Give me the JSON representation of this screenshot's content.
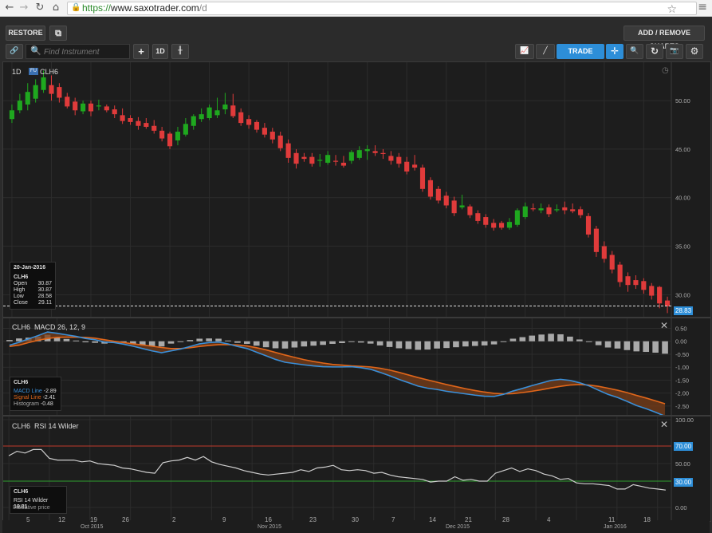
{
  "browser": {
    "url_scheme": "https://",
    "url_host": "www.saxotrader.com",
    "url_path": "/d",
    "back_icon": "←",
    "forward_icon": "→",
    "reload_icon": "↻",
    "home_icon": "⌂",
    "star_icon": "☆",
    "menu_icon": "≡"
  },
  "toolbar": {
    "restore_label": "RESTORE",
    "popout_icon": "⧉",
    "add_remove_label": "ADD / REMOVE CHARTS",
    "link_icon": "🔗",
    "search_icon": "🔍",
    "find_placeholder": "Find Instrument",
    "plus_icon": "+",
    "interval_label": "1D",
    "candles_icon": "╫",
    "indicators_icon": "📈",
    "draw_icon": "╱",
    "trade_label": "TRADE",
    "crosshair_icon": "✛",
    "zoom_icon": "🔍",
    "refresh_icon": "↻",
    "camera_icon": "📷",
    "settings_icon": "⚙"
  },
  "main_chart": {
    "interval": "1D",
    "fu_badge": "FU",
    "symbol": "CLH6",
    "clock_icon": "◷",
    "info": {
      "date": "20-Jan-2016",
      "symbol": "CLH6",
      "open_label": "Open",
      "open": "30.87",
      "high_label": "High",
      "high": "30.87",
      "low_label": "Low",
      "low": "28.58",
      "close_label": "Close",
      "close": "29.11"
    },
    "last_price": "28.83"
  },
  "macd_panel": {
    "title_symbol": "CLH6",
    "title": "MACD 26, 12, 9",
    "close_icon": "✕",
    "info": {
      "symbol": "CLH6",
      "macd_label": "MACD Line",
      "macd": "-2.89",
      "signal_label": "Signal Line",
      "signal": "-2.41",
      "hist_label": "Histogram",
      "hist": "-0.48"
    }
  },
  "rsi_panel": {
    "title_symbol": "CLH6",
    "title": "RSI 14 Wilder",
    "close_icon": "✕",
    "info": {
      "symbol": "CLH6",
      "rsi_label": "RSI 14 Wilder",
      "rsi": "19.81"
    },
    "indicative": "Indicative price",
    "upper_level": "70.00",
    "lower_level": "30.00"
  },
  "x_axis": {
    "days": [
      "5",
      "12",
      "19",
      "26",
      "2",
      "9",
      "16",
      "23",
      "30",
      "7",
      "14",
      "21",
      "28",
      "4",
      "11",
      "18"
    ],
    "months": [
      "Oct 2015",
      "Nov 2015",
      "Dec 2015",
      "Jan 2016"
    ]
  },
  "colors": {
    "up": "#1fa81f",
    "down": "#e03b3b",
    "macd": "#3a8fd8",
    "signal": "#e0661a",
    "rsi": "#cfcfcf",
    "accent": "#2d8ed8"
  },
  "chart_data": [
    {
      "type": "candlestick",
      "title": "CLH6",
      "y_ticks": [
        "50.00",
        "45.00",
        "40.00",
        "35.00",
        "30.00"
      ],
      "ylim": [
        28.3,
        53.3
      ],
      "candles": [
        {
          "o": 48.1,
          "h": 49.6,
          "l": 47.7,
          "c": 49.0
        },
        {
          "o": 49.0,
          "h": 50.7,
          "l": 48.7,
          "c": 50.0
        },
        {
          "o": 49.6,
          "h": 51.8,
          "l": 49.0,
          "c": 50.9
        },
        {
          "o": 50.2,
          "h": 52.2,
          "l": 49.8,
          "c": 51.6
        },
        {
          "o": 51.1,
          "h": 53.1,
          "l": 50.8,
          "c": 52.4
        },
        {
          "o": 51.6,
          "h": 52.6,
          "l": 50.0,
          "c": 50.7
        },
        {
          "o": 51.4,
          "h": 51.8,
          "l": 49.8,
          "c": 50.3
        },
        {
          "o": 50.4,
          "h": 50.8,
          "l": 49.2,
          "c": 49.4
        },
        {
          "o": 49.9,
          "h": 50.3,
          "l": 48.5,
          "c": 49.0
        },
        {
          "o": 48.9,
          "h": 50.0,
          "l": 48.6,
          "c": 49.7
        },
        {
          "o": 49.7,
          "h": 50.0,
          "l": 48.4,
          "c": 48.9
        },
        {
          "o": 49.4,
          "h": 50.1,
          "l": 49.0,
          "c": 49.5
        },
        {
          "o": 49.4,
          "h": 49.6,
          "l": 48.8,
          "c": 49.0
        },
        {
          "o": 49.1,
          "h": 49.5,
          "l": 48.2,
          "c": 48.6
        },
        {
          "o": 48.5,
          "h": 49.2,
          "l": 47.6,
          "c": 47.9
        },
        {
          "o": 48.2,
          "h": 48.5,
          "l": 47.5,
          "c": 47.8
        },
        {
          "o": 47.9,
          "h": 48.3,
          "l": 47.0,
          "c": 47.4
        },
        {
          "o": 47.7,
          "h": 48.2,
          "l": 47.1,
          "c": 47.3
        },
        {
          "o": 47.4,
          "h": 48.0,
          "l": 46.6,
          "c": 46.9
        },
        {
          "o": 46.9,
          "h": 47.3,
          "l": 45.8,
          "c": 46.1
        },
        {
          "o": 46.6,
          "h": 46.8,
          "l": 45.0,
          "c": 45.3
        },
        {
          "o": 45.9,
          "h": 47.3,
          "l": 45.4,
          "c": 46.8
        },
        {
          "o": 46.5,
          "h": 48.2,
          "l": 46.3,
          "c": 47.6
        },
        {
          "o": 47.4,
          "h": 48.6,
          "l": 47.0,
          "c": 48.4
        },
        {
          "o": 48.1,
          "h": 49.2,
          "l": 47.8,
          "c": 48.6
        },
        {
          "o": 48.2,
          "h": 49.6,
          "l": 48.0,
          "c": 49.3
        },
        {
          "o": 48.5,
          "h": 50.3,
          "l": 48.2,
          "c": 49.0
        },
        {
          "o": 49.1,
          "h": 50.8,
          "l": 48.6,
          "c": 49.6
        },
        {
          "o": 49.5,
          "h": 50.7,
          "l": 48.2,
          "c": 48.4
        },
        {
          "o": 48.8,
          "h": 49.2,
          "l": 47.4,
          "c": 47.7
        },
        {
          "o": 48.1,
          "h": 48.5,
          "l": 47.1,
          "c": 47.5
        },
        {
          "o": 47.8,
          "h": 48.0,
          "l": 46.7,
          "c": 47.0
        },
        {
          "o": 47.2,
          "h": 47.7,
          "l": 46.2,
          "c": 46.5
        },
        {
          "o": 46.8,
          "h": 47.2,
          "l": 45.6,
          "c": 46.0
        },
        {
          "o": 46.4,
          "h": 46.8,
          "l": 44.8,
          "c": 45.1
        },
        {
          "o": 45.6,
          "h": 46.0,
          "l": 43.6,
          "c": 44.1
        },
        {
          "o": 44.6,
          "h": 45.0,
          "l": 43.0,
          "c": 43.5
        },
        {
          "o": 44.2,
          "h": 44.6,
          "l": 43.7,
          "c": 44.0
        },
        {
          "o": 44.2,
          "h": 44.6,
          "l": 43.2,
          "c": 43.5
        },
        {
          "o": 43.8,
          "h": 44.5,
          "l": 43.2,
          "c": 43.9
        },
        {
          "o": 43.6,
          "h": 44.8,
          "l": 43.4,
          "c": 44.4
        },
        {
          "o": 43.8,
          "h": 44.4,
          "l": 43.3,
          "c": 43.7
        },
        {
          "o": 43.6,
          "h": 44.3,
          "l": 43.1,
          "c": 43.3
        },
        {
          "o": 43.8,
          "h": 44.9,
          "l": 43.5,
          "c": 44.7
        },
        {
          "o": 44.1,
          "h": 45.3,
          "l": 43.9,
          "c": 44.9
        },
        {
          "o": 44.8,
          "h": 45.4,
          "l": 43.9,
          "c": 45.0
        },
        {
          "o": 44.8,
          "h": 45.4,
          "l": 44.3,
          "c": 44.6
        },
        {
          "o": 44.6,
          "h": 45.0,
          "l": 44.0,
          "c": 44.5
        },
        {
          "o": 44.3,
          "h": 44.8,
          "l": 43.4,
          "c": 43.8
        },
        {
          "o": 44.2,
          "h": 44.6,
          "l": 43.1,
          "c": 43.5
        },
        {
          "o": 43.7,
          "h": 44.2,
          "l": 42.4,
          "c": 42.7
        },
        {
          "o": 43.4,
          "h": 44.4,
          "l": 42.8,
          "c": 43.1
        },
        {
          "o": 43.1,
          "h": 43.4,
          "l": 40.6,
          "c": 40.9
        },
        {
          "o": 41.8,
          "h": 42.1,
          "l": 39.8,
          "c": 40.1
        },
        {
          "o": 40.9,
          "h": 41.2,
          "l": 39.4,
          "c": 39.7
        },
        {
          "o": 40.2,
          "h": 40.6,
          "l": 38.9,
          "c": 39.2
        },
        {
          "o": 39.7,
          "h": 40.1,
          "l": 38.1,
          "c": 38.4
        },
        {
          "o": 39.0,
          "h": 40.3,
          "l": 38.8,
          "c": 39.2
        },
        {
          "o": 39.1,
          "h": 39.3,
          "l": 37.9,
          "c": 38.2
        },
        {
          "o": 38.4,
          "h": 38.7,
          "l": 37.3,
          "c": 37.6
        },
        {
          "o": 38.0,
          "h": 38.3,
          "l": 36.9,
          "c": 37.2
        },
        {
          "o": 37.4,
          "h": 37.8,
          "l": 36.6,
          "c": 36.9
        },
        {
          "o": 37.4,
          "h": 37.6,
          "l": 36.7,
          "c": 36.9
        },
        {
          "o": 36.9,
          "h": 37.9,
          "l": 36.7,
          "c": 37.5
        },
        {
          "o": 37.2,
          "h": 38.9,
          "l": 37.0,
          "c": 38.7
        },
        {
          "o": 38.0,
          "h": 39.5,
          "l": 37.8,
          "c": 39.1
        },
        {
          "o": 38.9,
          "h": 39.4,
          "l": 38.6,
          "c": 38.8
        },
        {
          "o": 38.7,
          "h": 39.4,
          "l": 38.4,
          "c": 38.9
        },
        {
          "o": 39.0,
          "h": 39.3,
          "l": 38.0,
          "c": 38.3
        },
        {
          "o": 38.7,
          "h": 39.3,
          "l": 38.5,
          "c": 38.8
        },
        {
          "o": 39.0,
          "h": 39.6,
          "l": 38.3,
          "c": 38.7
        },
        {
          "o": 38.8,
          "h": 39.4,
          "l": 38.4,
          "c": 38.6
        },
        {
          "o": 38.8,
          "h": 39.1,
          "l": 37.9,
          "c": 38.2
        },
        {
          "o": 38.1,
          "h": 38.4,
          "l": 35.9,
          "c": 36.2
        },
        {
          "o": 36.8,
          "h": 37.1,
          "l": 33.9,
          "c": 34.4
        },
        {
          "o": 35.0,
          "h": 35.5,
          "l": 33.3,
          "c": 33.7
        },
        {
          "o": 34.1,
          "h": 34.5,
          "l": 32.2,
          "c": 32.6
        },
        {
          "o": 33.1,
          "h": 33.4,
          "l": 30.8,
          "c": 31.3
        },
        {
          "o": 31.9,
          "h": 32.3,
          "l": 30.3,
          "c": 31.0
        },
        {
          "o": 31.5,
          "h": 32.0,
          "l": 30.6,
          "c": 31.0
        },
        {
          "o": 31.4,
          "h": 31.7,
          "l": 30.1,
          "c": 30.5
        },
        {
          "o": 30.9,
          "h": 31.2,
          "l": 29.5,
          "c": 29.9
        },
        {
          "o": 30.8,
          "h": 30.9,
          "l": 28.6,
          "c": 29.1
        },
        {
          "o": 29.4,
          "h": 29.8,
          "l": 28.1,
          "c": 28.8
        }
      ]
    },
    {
      "type": "line",
      "title": "MACD 26, 12, 9",
      "y_ticks": [
        "0.50",
        "0.00",
        "-0.50",
        "-1.00",
        "-1.50",
        "-2.00",
        "-2.50"
      ],
      "ylim": [
        -2.75,
        0.7
      ],
      "series": [
        {
          "name": "MACD Line",
          "values": [
            -0.15,
            -0.04,
            0.09,
            0.22,
            0.36,
            0.31,
            0.25,
            0.19,
            0.11,
            0.06,
            -0.03,
            -0.05,
            -0.11,
            -0.19,
            -0.28,
            -0.37,
            -0.44,
            -0.37,
            -0.3,
            -0.2,
            -0.1,
            -0.05,
            -0.03,
            -0.1,
            -0.2,
            -0.28,
            -0.42,
            -0.56,
            -0.7,
            -0.81,
            -0.86,
            -0.91,
            -0.95,
            -0.98,
            -0.99,
            -0.99,
            -0.98,
            -1.02,
            -1.08,
            -1.2,
            -1.33,
            -1.47,
            -1.6,
            -1.73,
            -1.81,
            -1.86,
            -1.93,
            -1.98,
            -2.03,
            -2.08,
            -2.12,
            -2.13,
            -2.05,
            -1.92,
            -1.82,
            -1.71,
            -1.61,
            -1.51,
            -1.47,
            -1.51,
            -1.6,
            -1.72,
            -1.89,
            -2.05,
            -2.17,
            -2.32,
            -2.48,
            -2.6,
            -2.74,
            -2.89
          ]
        },
        {
          "name": "Signal Line",
          "values": [
            -0.2,
            -0.15,
            -0.05,
            0.04,
            0.11,
            0.15,
            0.16,
            0.16,
            0.15,
            0.12,
            0.06,
            0.0,
            -0.05,
            -0.1,
            -0.14,
            -0.19,
            -0.24,
            -0.28,
            -0.28,
            -0.25,
            -0.2,
            -0.16,
            -0.13,
            -0.13,
            -0.14,
            -0.18,
            -0.25,
            -0.33,
            -0.43,
            -0.53,
            -0.62,
            -0.71,
            -0.78,
            -0.84,
            -0.89,
            -0.92,
            -0.95,
            -0.97,
            -0.99,
            -1.04,
            -1.11,
            -1.2,
            -1.3,
            -1.4,
            -1.49,
            -1.58,
            -1.67,
            -1.75,
            -1.83,
            -1.9,
            -1.96,
            -2.01,
            -2.03,
            -2.02,
            -1.98,
            -1.93,
            -1.87,
            -1.8,
            -1.74,
            -1.69,
            -1.67,
            -1.69,
            -1.74,
            -1.81,
            -1.89,
            -1.98,
            -2.09,
            -2.19,
            -2.3,
            -2.41
          ]
        },
        {
          "name": "Histogram",
          "values": [
            0.05,
            0.11,
            0.14,
            0.18,
            0.25,
            0.16,
            0.09,
            0.03,
            -0.04,
            -0.06,
            -0.09,
            -0.05,
            -0.06,
            -0.09,
            -0.14,
            -0.18,
            -0.2,
            -0.09,
            -0.02,
            0.05,
            0.1,
            0.11,
            0.1,
            0.03,
            -0.06,
            -0.1,
            -0.17,
            -0.23,
            -0.27,
            -0.28,
            -0.24,
            -0.2,
            -0.17,
            -0.14,
            -0.1,
            -0.07,
            -0.03,
            -0.05,
            -0.09,
            -0.16,
            -0.22,
            -0.27,
            -0.3,
            -0.33,
            -0.32,
            -0.28,
            -0.26,
            -0.23,
            -0.2,
            -0.18,
            -0.16,
            -0.12,
            -0.02,
            0.1,
            0.16,
            0.22,
            0.26,
            0.29,
            0.27,
            0.18,
            0.07,
            -0.03,
            -0.15,
            -0.24,
            -0.28,
            -0.34,
            -0.39,
            -0.41,
            -0.44,
            -0.48
          ]
        }
      ]
    },
    {
      "type": "line",
      "title": "RSI 14 Wilder",
      "y_ticks": [
        "100.00",
        "70.00",
        "50.00",
        "30.00",
        "0.00"
      ],
      "ylim": [
        0,
        100
      ],
      "series": [
        {
          "name": "RSI 14 Wilder",
          "values": [
            59,
            64,
            62,
            66,
            66,
            56,
            54,
            54,
            54,
            52,
            53,
            50,
            49,
            48,
            45,
            44,
            42,
            40,
            39,
            51,
            53,
            54,
            57,
            54,
            58,
            52,
            49,
            47,
            45,
            42,
            40,
            38,
            37,
            38,
            39,
            40,
            43,
            41,
            45,
            46,
            48,
            43,
            42,
            43,
            42,
            39,
            40,
            37,
            35,
            34,
            33,
            32,
            29,
            30,
            30,
            35,
            31,
            32,
            30,
            30,
            39,
            42,
            45,
            41,
            44,
            42,
            38,
            36,
            32,
            33,
            28,
            27,
            27,
            26,
            25,
            21,
            21,
            26,
            24,
            22,
            21,
            19.81
          ]
        }
      ]
    }
  ]
}
